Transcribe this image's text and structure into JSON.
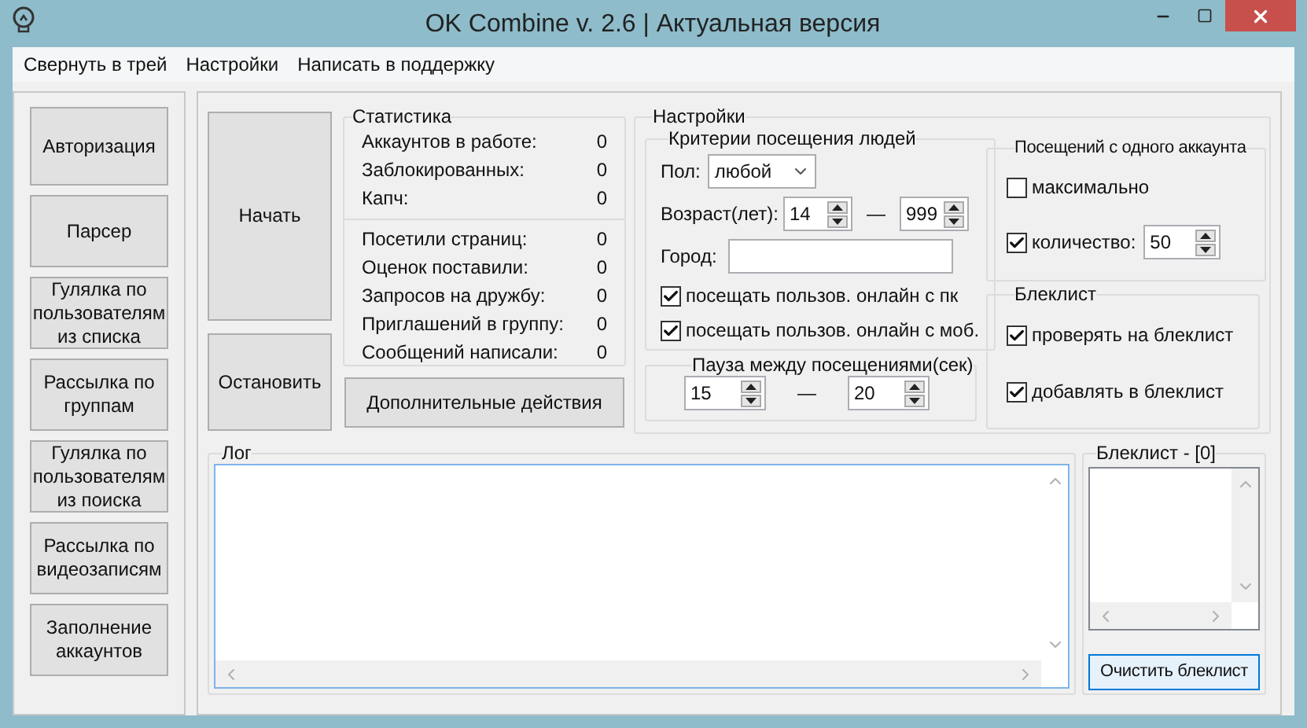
{
  "window": {
    "title": "OK Combine v. 2.6 | Актуальная версия"
  },
  "menu": [
    "Свернуть в трей",
    "Настройки",
    "Написать в поддержку"
  ],
  "sidebar": {
    "buttons": [
      "Авторизация",
      "Парсер",
      "Гулялка по пользователям из списка",
      "Рассылка по группам",
      "Гулялка по пользователям из поиска",
      "Рассылка по видеозаписям",
      "Заполнение аккаунтов"
    ]
  },
  "actions": {
    "start": "Начать",
    "stop": "Остановить",
    "more": "Дополнительные действия"
  },
  "stats": {
    "title": "Статистика",
    "groups": [
      [
        {
          "label": "Аккаунтов в работе:",
          "value": "0"
        },
        {
          "label": "Заблокированных:",
          "value": "0"
        },
        {
          "label": "Капч:",
          "value": "0"
        }
      ],
      [
        {
          "label": "Посетили страниц:",
          "value": "0"
        },
        {
          "label": "Оценок поставили:",
          "value": "0"
        },
        {
          "label": "Запросов на дружбу:",
          "value": "0"
        },
        {
          "label": "Приглашений в группу:",
          "value": "0"
        },
        {
          "label": "Сообщений написали:",
          "value": "0"
        }
      ]
    ]
  },
  "settings": {
    "title": "Настройки",
    "criteria": {
      "title": "Критерии посещения людей",
      "gender": {
        "label": "Пол:",
        "value": "любой"
      },
      "age": {
        "label": "Возраст(лет):",
        "from": "14",
        "separator": "—",
        "to": "999"
      },
      "city": {
        "label": "Город:"
      },
      "checkboxes": [
        {
          "label": "посещать пользов. онлайн с пк",
          "checked": true
        },
        {
          "label": "посещать пользов. онлайн с моб.",
          "checked": true
        }
      ]
    },
    "pause": {
      "title": "Пауза между посещениями(сек)",
      "from": "15",
      "separator": "—",
      "to": "20"
    },
    "visits": {
      "title": "Посещений с одного аккаунта",
      "max": {
        "label": "максимально",
        "checked": false
      },
      "count": {
        "label": "количество:",
        "checked": true,
        "value": "50"
      }
    },
    "blacklist": {
      "title": "Блеклист",
      "checkboxes": [
        {
          "label": "проверять на блеклист",
          "checked": true
        },
        {
          "label": "добавлять в блеклист",
          "checked": true
        }
      ]
    }
  },
  "log": {
    "title": "Лог"
  },
  "blacklist_panel": {
    "title": "Блеклист - [0]",
    "clear_button": "Очистить блеклист"
  }
}
